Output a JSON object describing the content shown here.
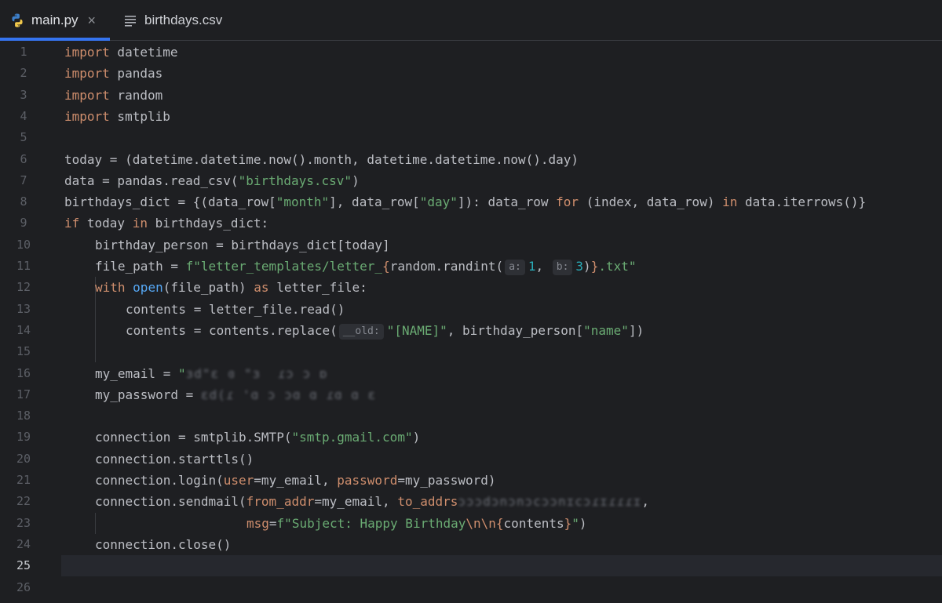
{
  "tabs": [
    {
      "label": "main.py",
      "active": true
    },
    {
      "label": "birthdays.csv",
      "active": false
    }
  ],
  "editor": {
    "line_numbers": [
      "1",
      "2",
      "3",
      "4",
      "5",
      "6",
      "7",
      "8",
      "9",
      "10",
      "11",
      "12",
      "13",
      "14",
      "15",
      "16",
      "17",
      "18",
      "19",
      "20",
      "21",
      "22",
      "23",
      "24",
      "25",
      "26"
    ],
    "current_line": "25",
    "code": {
      "l1": {
        "kw": "import",
        "t": " datetime"
      },
      "l2": {
        "kw": "import",
        "t": " pandas"
      },
      "l3": {
        "kw": "import",
        "t": " random"
      },
      "l4": {
        "kw": "import",
        "t": " smtplib"
      },
      "l6": {
        "t": "today = (datetime.datetime.now().month, datetime.datetime.now().day)"
      },
      "l7": {
        "a": "data = pandas.read_csv(",
        "s": "\"birthdays.csv\"",
        "b": ")"
      },
      "l8": {
        "a": "birthdays_dict = {(data_row[",
        "s1": "\"month\"",
        "b": "], data_row[",
        "s2": "\"day\"",
        "c": "]): data_row ",
        "kw1": "for",
        "d": " (index, data_row) ",
        "kw2": "in",
        "e": " data.iterrows()}"
      },
      "l9": {
        "kw1": "if",
        "a": " today ",
        "kw2": "in",
        "b": " birthdays_dict:"
      },
      "l10": {
        "t": "birthday_person = birthdays_dict[today]"
      },
      "l11": {
        "a": "file_path = ",
        "s1": "f\"letter_templates/letter_",
        "br1": "{",
        "b": "random.randint(",
        "h1": "a:",
        "n1": "1",
        "c": ", ",
        "h2": "b:",
        "n2": "3",
        "d": ")",
        "br2": "}",
        "s2": ".txt\""
      },
      "l12": {
        "kw1": "with",
        "a": " ",
        "fn": "open",
        "b": "(file_path) ",
        "kw2": "as",
        "c": " letter_file:"
      },
      "l13": {
        "t": "contents = letter_file.read()"
      },
      "l14": {
        "a": "contents = contents.replace(",
        "h": "__old:",
        "s1": "\"[NAME]\"",
        "b": ", birthday_person[",
        "s2": "\"name\"",
        "c": "])"
      },
      "l16": {
        "a": "my_email = ",
        "s": "\"",
        "r": "ɜd\"ɛ ɞ \"ɜ  ɾɔ ɔ ɒ"
      },
      "l17": {
        "a": "my_password = ",
        "r": "ɛd(ɾ 'ɑ ɔ ɔɑ ɑ ɾɑ ɑ ɛ"
      },
      "l19": {
        "a": "connection = smtplib.SMTP(",
        "s": "\"smtp.gmail.com\"",
        "b": ")"
      },
      "l20": {
        "t": "connection.starttls()"
      },
      "l21": {
        "a": "connection.login(",
        "p1": "user",
        "b": "=my_email, ",
        "p2": "password",
        "c": "=my_password)"
      },
      "l22": {
        "a": "connection.sendmail(",
        "p1": "from_addr",
        "b": "=my_email, ",
        "p2": "to_addrs",
        "r": "ɔɔɔdɔnɔnɔcɔɔnɪcɔɾɪɾɾɾɪ",
        "c": ","
      },
      "l23": {
        "p": "msg",
        "a": "=",
        "s1": "f\"Subject: Happy Birthday",
        "esc": "\\n\\n",
        "br1": "{",
        "b": "contents",
        "br2": "}",
        "s2": "\"",
        "c": ")"
      },
      "l24": {
        "t": "connection.close()"
      }
    }
  },
  "colors": {
    "background": "#1e1f22",
    "keyword": "#cf8e6d",
    "string": "#6aab73",
    "number": "#2aacb8",
    "named_param": "#c77dbb",
    "tab_accent": "#3574f0"
  }
}
